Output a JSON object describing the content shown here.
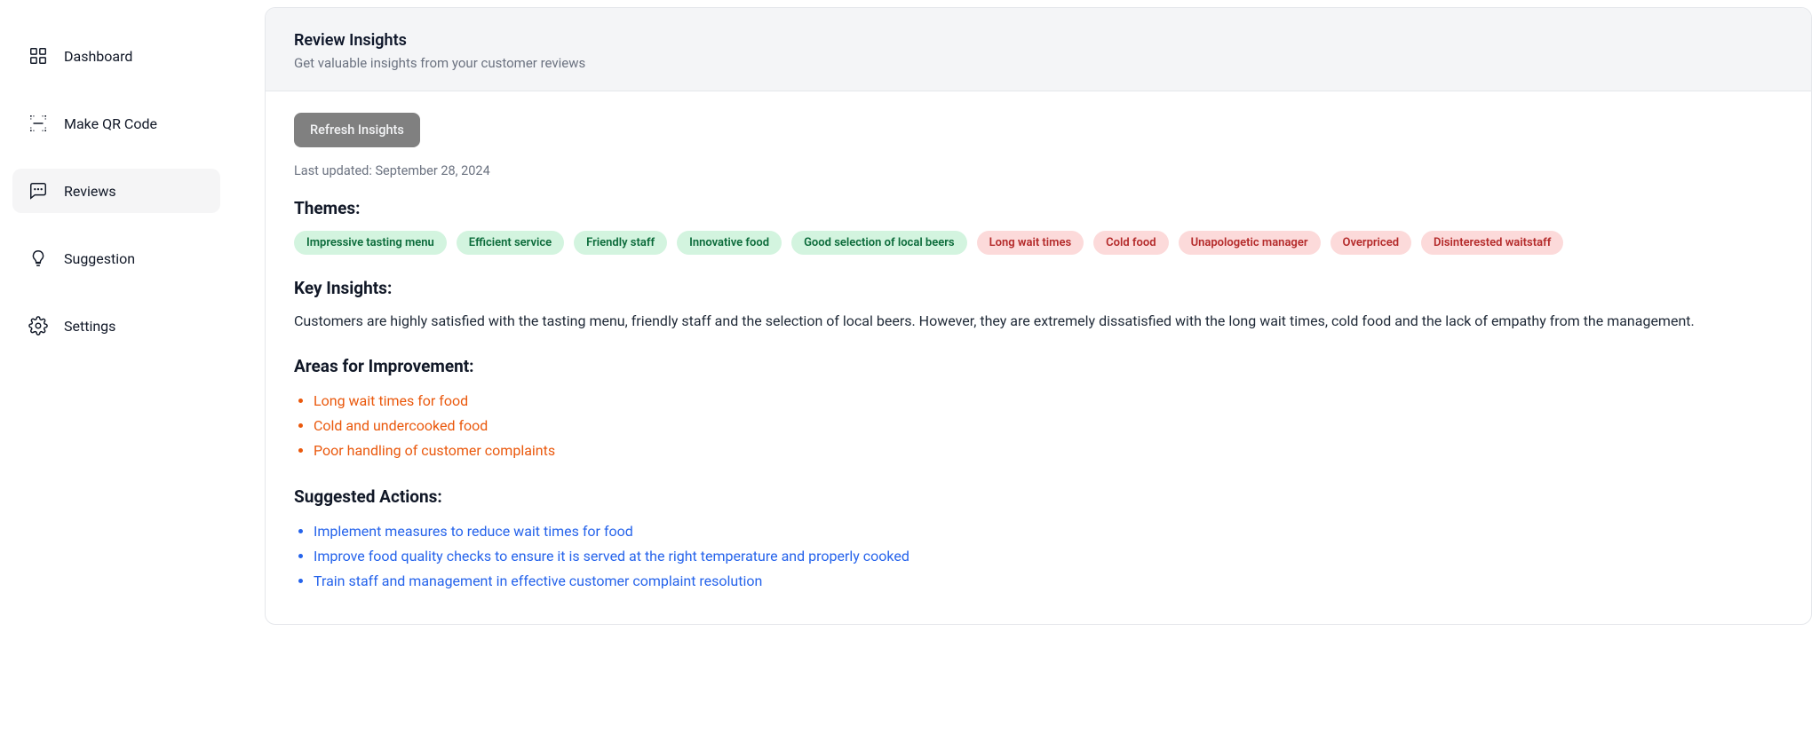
{
  "sidebar": {
    "items": [
      {
        "label": "Dashboard",
        "icon": "dashboard-icon",
        "active": false
      },
      {
        "label": "Make QR Code",
        "icon": "qr-code-icon",
        "active": false
      },
      {
        "label": "Reviews",
        "icon": "reviews-icon",
        "active": true
      },
      {
        "label": "Suggestion",
        "icon": "suggestion-icon",
        "active": false
      },
      {
        "label": "Settings",
        "icon": "settings-icon",
        "active": false
      }
    ]
  },
  "header": {
    "title": "Review Insights",
    "subtitle": "Get valuable insights from your customer reviews"
  },
  "actions": {
    "refresh_label": "Refresh Insights",
    "last_updated": "Last updated: September 28, 2024"
  },
  "themes": {
    "heading": "Themes:",
    "positive": [
      "Impressive tasting menu",
      "Efficient service",
      "Friendly staff",
      "Innovative food",
      "Good selection of local beers"
    ],
    "negative": [
      "Long wait times",
      "Cold food",
      "Unapologetic manager",
      "Overpriced",
      "Disinterested waitstaff"
    ]
  },
  "key_insights": {
    "heading": "Key Insights:",
    "text": "Customers are highly satisfied with the tasting menu, friendly staff and the selection of local beers. However, they are extremely dissatisfied with the long wait times, cold food and the lack of empathy from the management."
  },
  "areas_for_improvement": {
    "heading": "Areas for Improvement:",
    "items": [
      "Long wait times for food",
      "Cold and undercooked food",
      "Poor handling of customer complaints"
    ]
  },
  "suggested_actions": {
    "heading": "Suggested Actions:",
    "items": [
      "Implement measures to reduce wait times for food",
      "Improve food quality checks to ensure it is served at the right temperature and properly cooked",
      "Train staff and management in effective customer complaint resolution"
    ]
  }
}
